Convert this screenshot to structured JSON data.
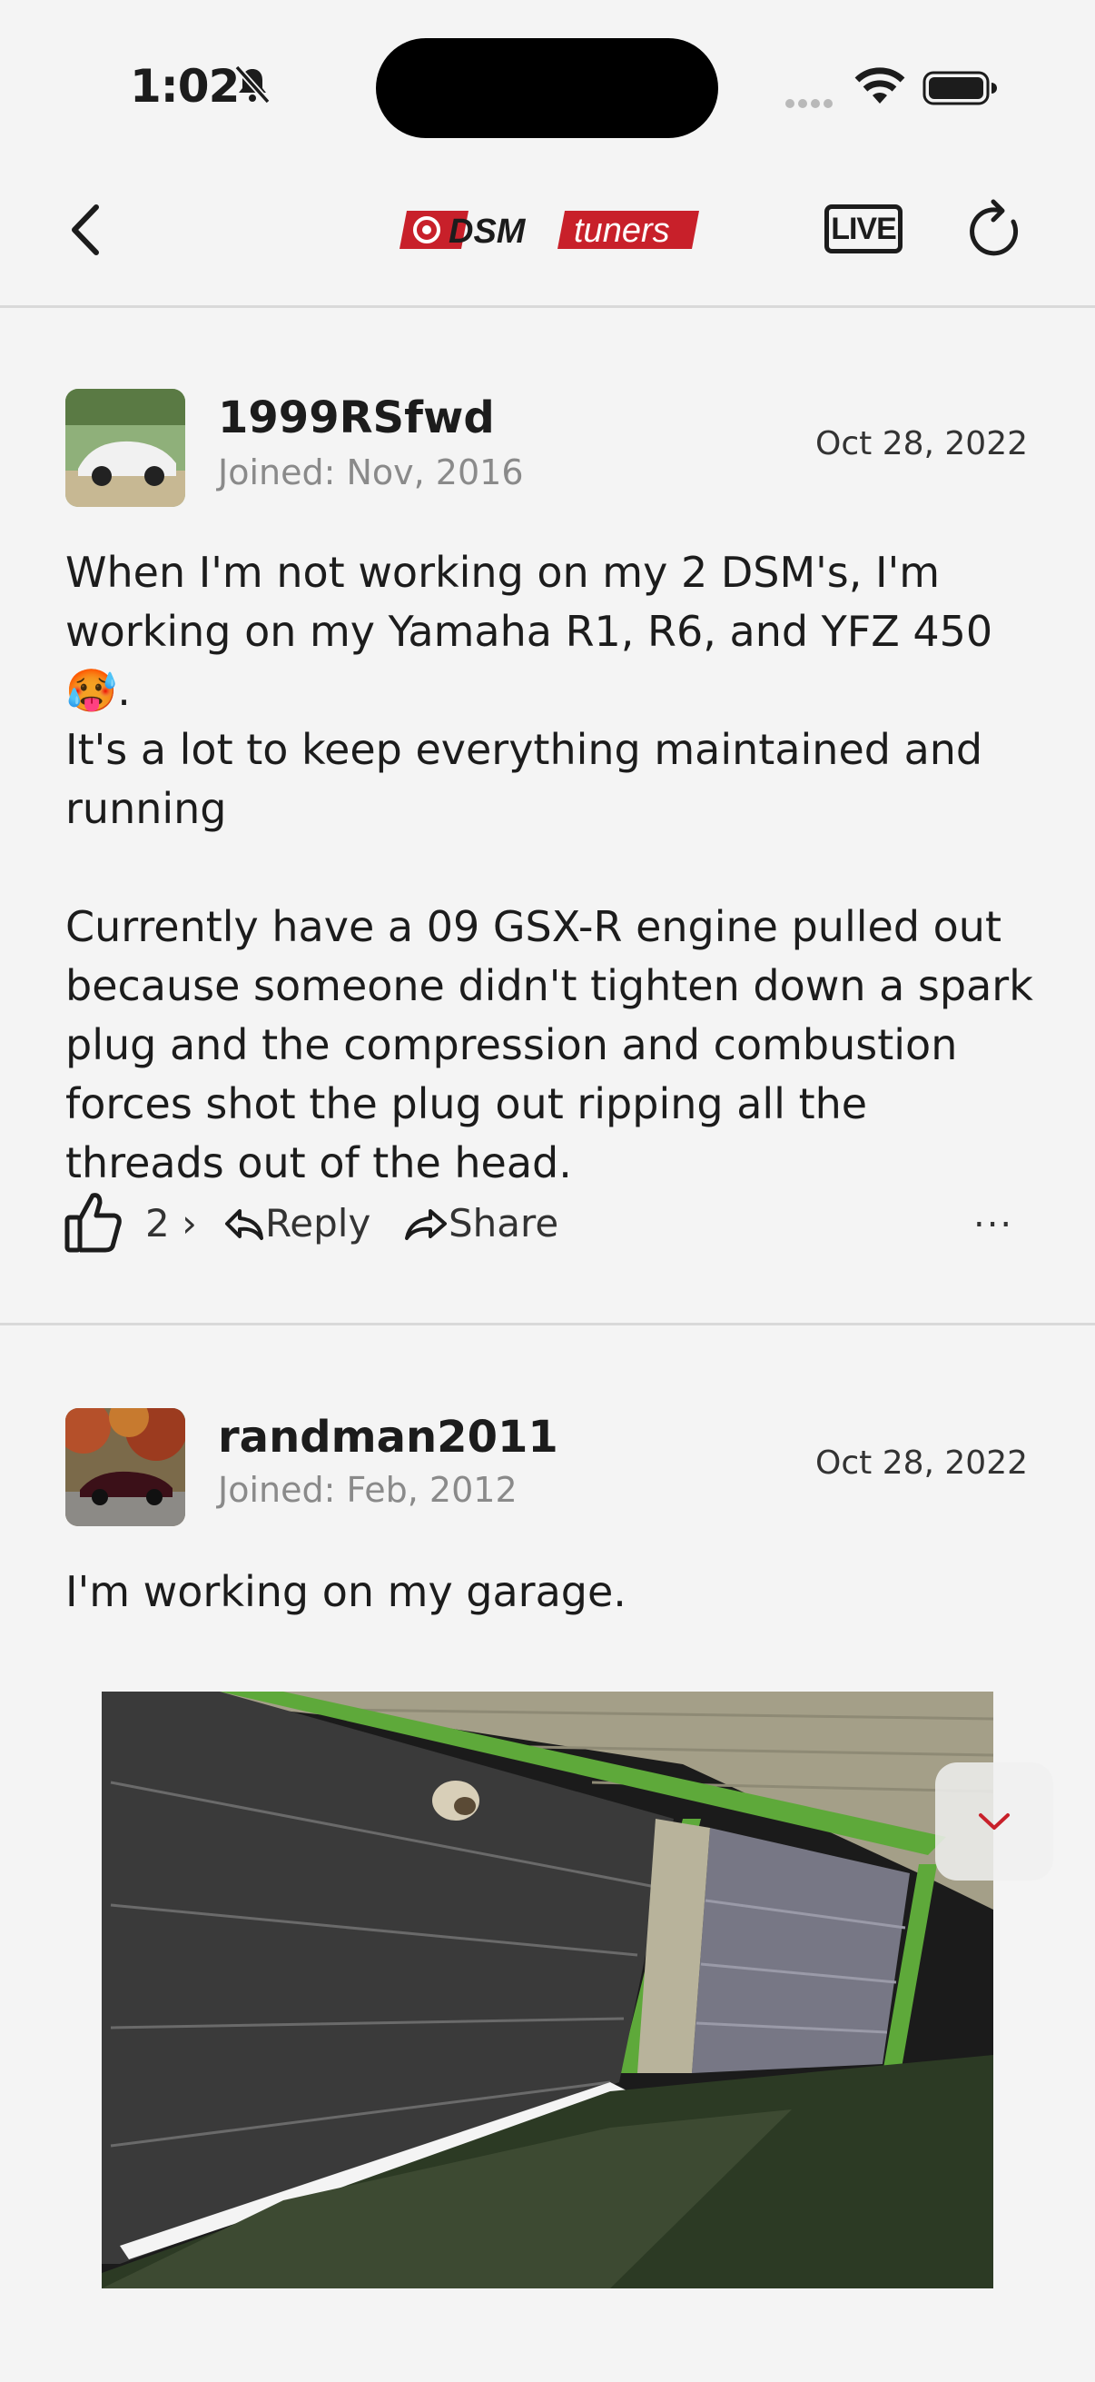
{
  "status_bar": {
    "time": "1:02"
  },
  "nav": {
    "logo_text_1": "DSM",
    "logo_text_2": "tuners",
    "live_label": "LIVE"
  },
  "posts": [
    {
      "username": "1999RSfwd",
      "joined": "Joined: Nov, 2016",
      "date": "Oct 28, 2022",
      "paragraph_1": "When I'm not working on my 2 DSM's, I'm working on my Yamaha R1, R6, and YFZ 450 🥵.",
      "paragraph_1b": "It's a lot to keep everything maintained and running",
      "paragraph_2": "Currently have a 09 GSX-R engine pulled out because someone didn't tighten down a spark plug and the compression and combustion forces shot the plug out ripping all the threads out of the head.",
      "like_count": "2 ›",
      "reply_label": "Reply",
      "share_label": "Share",
      "more_label": "..."
    },
    {
      "username": "randman2011",
      "joined": "Joined: Feb, 2012",
      "date": "Oct 28, 2022",
      "paragraph_1": "I'm working on my garage."
    }
  ],
  "colors": {
    "brand_red": "#c8202a",
    "accent_green": "#5ea93a"
  }
}
